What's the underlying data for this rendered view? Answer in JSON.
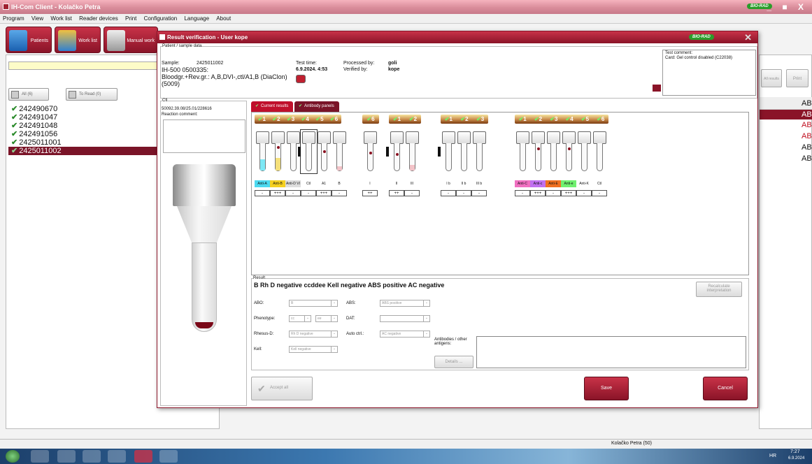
{
  "app": {
    "title": "IH-Com Client - Kolačko Petra",
    "brand": "BIO-RAD",
    "window_controls": "_ ■ X"
  },
  "menu": [
    "Program",
    "View",
    "Work list",
    "Reader devices",
    "Print",
    "Configuration",
    "Language",
    "About"
  ],
  "toolbar": {
    "patients": "Patients",
    "worklist": "Work list",
    "manual": "Manual work"
  },
  "filters": {
    "all": "All (6)",
    "to_read": "To Read (0)"
  },
  "samples": [
    {
      "id": "242490670",
      "selected": false
    },
    {
      "id": "242491047",
      "selected": false
    },
    {
      "id": "242491048",
      "selected": false
    },
    {
      "id": "242491056",
      "selected": false
    },
    {
      "id": "2425011001",
      "selected": false
    },
    {
      "id": "2425011002",
      "selected": true
    }
  ],
  "right": {
    "results_btn": "All results",
    "print_btn": "Print",
    "ab_items": [
      "AB",
      "AB",
      "AB",
      "AB",
      "AB",
      "AB"
    ]
  },
  "dialog": {
    "title": "Result verification - User kope",
    "patient_legend": "Patient / sample data",
    "sample_label": "Sample:",
    "sample_value": "2425011002",
    "ih_line": "IH-500 0500335:",
    "test_desc": "Bloodgr.+Rev.gr.: A,B,DVI-,ctl/A1,B (DiaClon)",
    "test_code": "(5009)",
    "test_time_label": "Test time:",
    "test_time_value": "6.9.2024. 4:53",
    "processed_label": "Processed by:",
    "processed_value": "goli",
    "verified_label": "Verified by:",
    "verified_value": "kope",
    "comment_label": "Test comment:",
    "comment_value": "Card: Gel control disabled (C22038)",
    "ctl_legend": "Ctl",
    "ctl_id": "50092.39.08/25.01/228616",
    "reaction_comment": "Reaction comment:",
    "tab_current": "Current results",
    "tab_antibody": "Antibody panels"
  },
  "cards": [
    {
      "numbers": [
        "1",
        "2",
        "3",
        "4",
        "5",
        "6"
      ],
      "labels": [
        "Anti-A",
        "Anti-B",
        "Anti-D VI -",
        "Ctl",
        "A1",
        "B"
      ],
      "values": [
        "-",
        "+++",
        "-",
        "-",
        "+++",
        "-"
      ]
    },
    {
      "numbers": [
        "6"
      ],
      "labels": [
        "I"
      ],
      "values": [
        "++"
      ]
    },
    {
      "numbers": [
        "1",
        "2"
      ],
      "labels": [
        "II",
        "III"
      ],
      "values": [
        "++",
        "-"
      ]
    },
    {
      "numbers": [
        "1",
        "2",
        "3"
      ],
      "labels": [
        "I b",
        "II b",
        "III b"
      ],
      "values": [
        "-",
        "-",
        "-"
      ]
    },
    {
      "numbers": [
        "1",
        "2",
        "3",
        "4",
        "5",
        "6"
      ],
      "labels": [
        "Anti-C",
        "Anti-c",
        "Anti-E",
        "Anti-e",
        "Anti-K",
        "Ctl"
      ],
      "values": [
        "-",
        "+++",
        "-",
        "+++",
        "-",
        "-"
      ]
    }
  ],
  "result": {
    "legend": "Result",
    "summary": "B Rh D negative ccddee Kell negative ABS positive AC negative",
    "recalc": "Recalculate interpretation",
    "abo_label": "ABO:",
    "abo_value": "B",
    "abs_label": "ABS:",
    "abs_value": "ABS positive",
    "phenotype_label": "Phenotype:",
    "pheno1": "cc",
    "pheno2": "ee",
    "dat_label": "DAT:",
    "dat_value": "",
    "rhesus_label": "Rhesus-D:",
    "rhesus_value": "Rh D negative",
    "autoctl_label": "Auto ctrl.:",
    "autoctl_value": "AC negative",
    "kell_label": "Kell:",
    "kell_value": "Kell negative",
    "antibodies_label": "Antibodies / other antigens:",
    "details": "Details ..."
  },
  "buttons": {
    "accept_all": "Accept all",
    "save": "Save",
    "cancel": "Cancel"
  },
  "status": {
    "user": "Kolačko Petra (50)"
  },
  "tray": {
    "lang": "HR",
    "time": "7:27",
    "date": "6.9.2024"
  },
  "colors": {
    "accent": "#8a1428",
    "anti_a": "#4dd9f0",
    "anti_b": "#f5d020",
    "anti_C": "#f070c0",
    "anti_c": "#c070f0",
    "anti_E": "#f07020",
    "anti_e": "#70f070"
  }
}
